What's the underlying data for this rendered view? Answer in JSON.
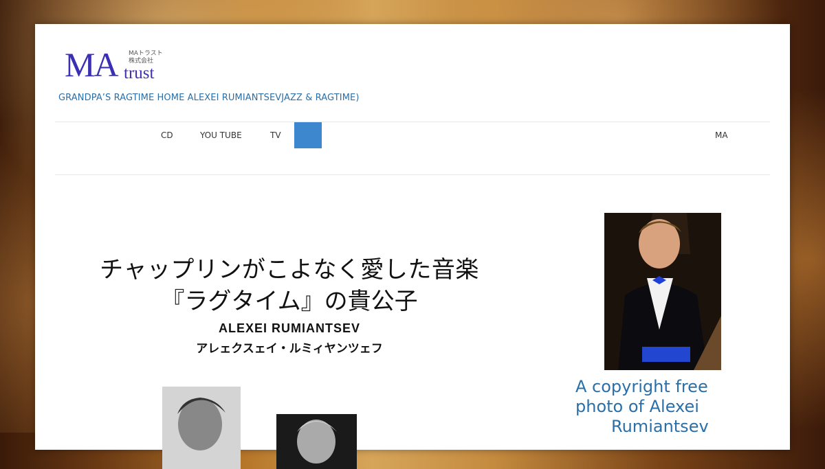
{
  "logo": {
    "ma": "MA",
    "trust": "trust",
    "sub_line1": "MAトラスト",
    "sub_line2": "株式会社"
  },
  "tagline": "GRANDPA’S RAGTIME HOME ALEXEI RUMIANTSEVJAZZ & RAGTIME)",
  "nav": {
    "items": [
      "CD",
      "YOU TUBE",
      "TV",
      "MA"
    ],
    "active_color": "#3d87cf"
  },
  "headline": {
    "line1": "チャップリンがこよなく愛した音楽",
    "line2": "『ラグタイム』の貴公子",
    "name_en": "ALEXEI  RUMIANTSEV",
    "name_ja": "アレェクスェイ・ルミィヤンツェフ"
  },
  "caption": {
    "line1": "A  copyright free",
    "line2": "photo of          Alexei",
    "line3": "Rumiantsev"
  },
  "colors": {
    "link": "#2a6fa8",
    "logo": "#3b2fb3"
  }
}
